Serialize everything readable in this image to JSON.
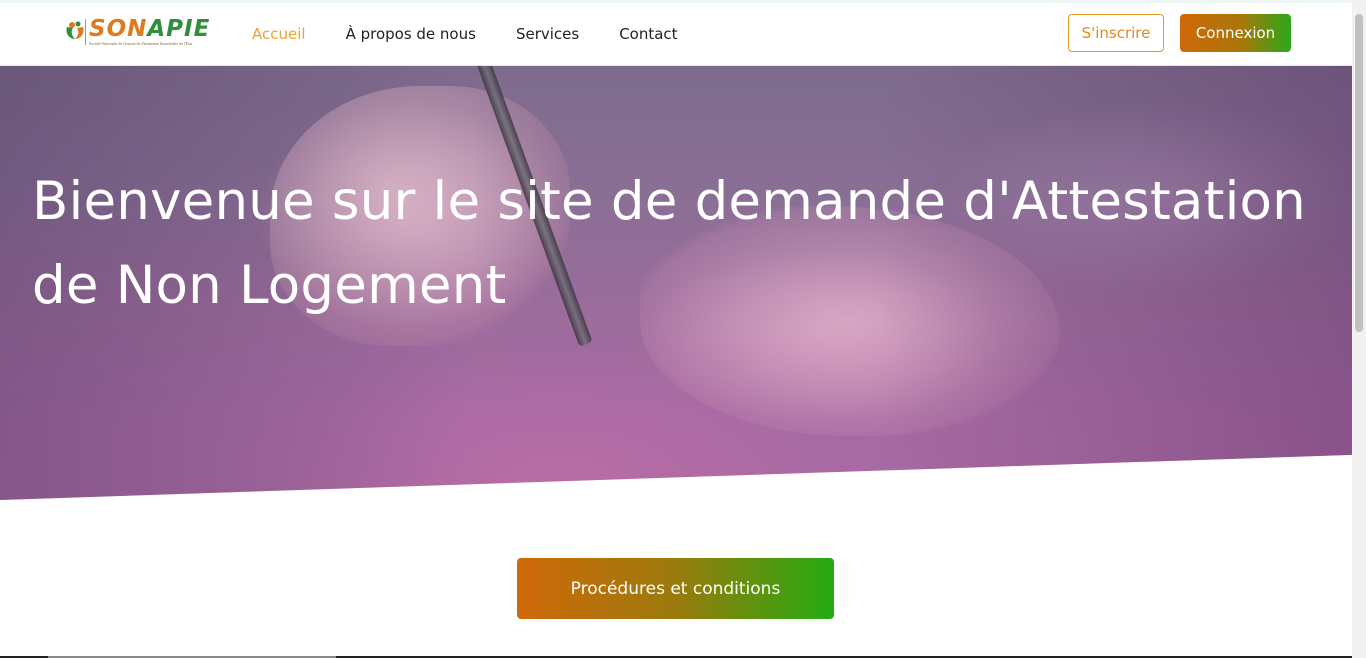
{
  "brand": {
    "name_part1": "SON",
    "name_part2": "APIE",
    "tagline": "Société Nationale de Gestion du Patrimoine Immobilier de l'Etat"
  },
  "nav": {
    "items": [
      {
        "label": "Accueil",
        "active": true
      },
      {
        "label": "À propos de nous",
        "active": false
      },
      {
        "label": "Services",
        "active": false
      },
      {
        "label": "Contact",
        "active": false
      }
    ]
  },
  "auth": {
    "register_label": "S'inscrire",
    "login_label": "Connexion"
  },
  "hero": {
    "title": "Bienvenue sur le site de demande d'Attestation de Non Logement"
  },
  "cta": {
    "label": "Procédures et conditions"
  },
  "colors": {
    "accent_orange": "#e08a1e",
    "accent_green": "#2ca81a",
    "hero_overlay": "#a66aa2"
  }
}
